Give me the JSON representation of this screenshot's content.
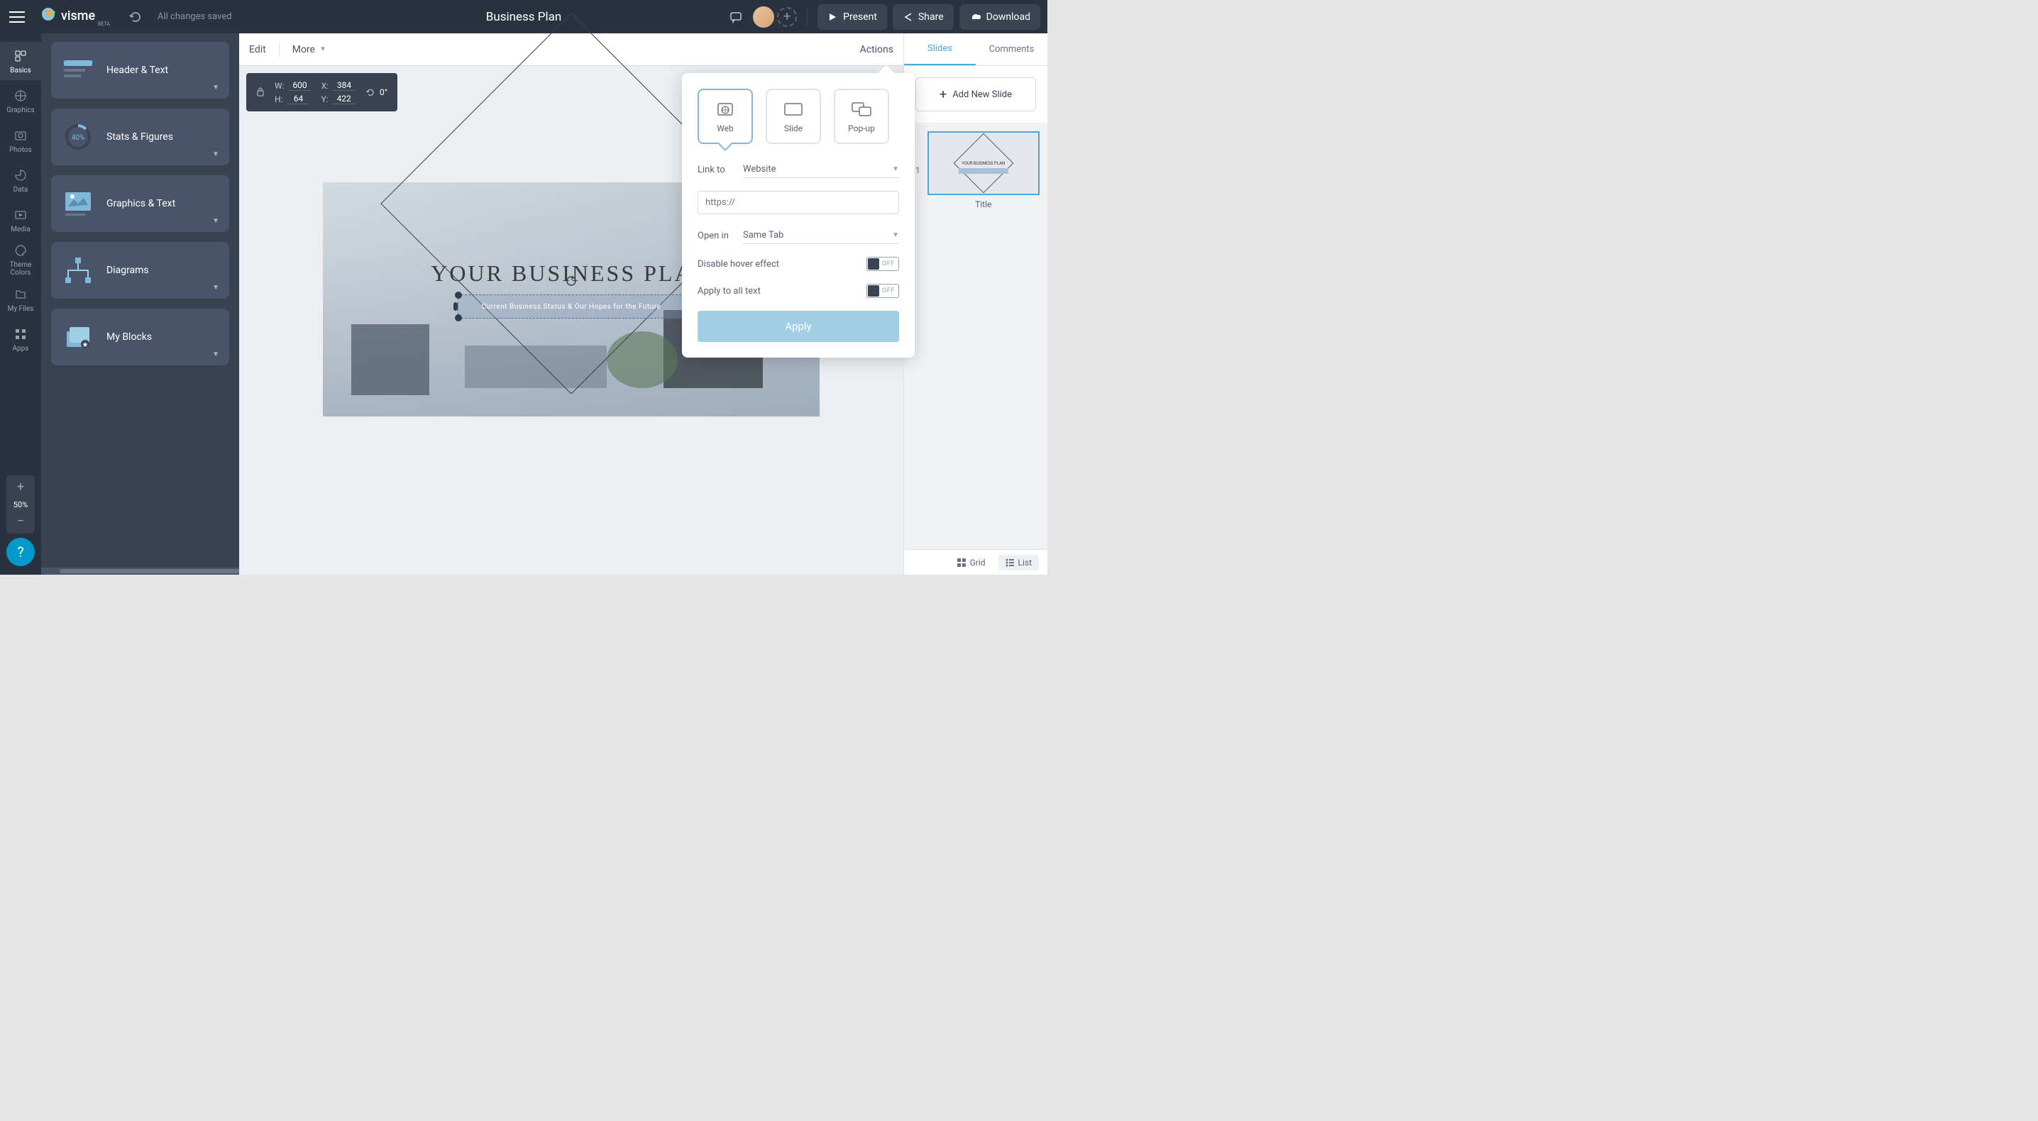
{
  "topbar": {
    "save_status": "All changes saved",
    "project_title": "Business Plan",
    "present": "Present",
    "share": "Share",
    "download": "Download",
    "add_user": "+",
    "logo_beta": "BETA"
  },
  "rail": {
    "items": [
      {
        "label": "Basics"
      },
      {
        "label": "Graphics"
      },
      {
        "label": "Photos"
      },
      {
        "label": "Data"
      },
      {
        "label": "Media"
      },
      {
        "label": "Theme Colors"
      },
      {
        "label": "My Files"
      },
      {
        "label": "Apps"
      }
    ],
    "zoom": "50%"
  },
  "blocks": [
    {
      "label": "Header & Text"
    },
    {
      "label": "Stats & Figures",
      "stat": "40%"
    },
    {
      "label": "Graphics & Text"
    },
    {
      "label": "Diagrams"
    },
    {
      "label": "My Blocks"
    }
  ],
  "canvas_toolbar": {
    "edit": "Edit",
    "more": "More",
    "actions": "Actions"
  },
  "dims": {
    "w_label": "W:",
    "w": "600",
    "h_label": "H:",
    "h": "64",
    "x_label": "X:",
    "x": "384",
    "y_label": "Y:",
    "y": "422",
    "rot": "0°"
  },
  "slide_content": {
    "title": "YOUR BUSINESS PLAN",
    "subtitle": "Current Business Status & Our Hopes for the Future"
  },
  "popover": {
    "types": [
      {
        "label": "Web"
      },
      {
        "label": "Slide"
      },
      {
        "label": "Pop-up"
      }
    ],
    "link_to_label": "Link to",
    "link_to_value": "Website",
    "url_placeholder": "https://",
    "open_in_label": "Open in",
    "open_in_value": "Same Tab",
    "disable_hover": "Disable hover effect",
    "apply_all": "Apply to all text",
    "toggle_off": "OFF",
    "apply_btn": "Apply"
  },
  "right": {
    "tabs": {
      "slides": "Slides",
      "comments": "Comments"
    },
    "add_slide": "Add New Slide",
    "slide1": {
      "num": "1",
      "label": "Title",
      "thumb_title": "YOUR BUSINESS PLAN"
    }
  },
  "view_bar": {
    "grid": "Grid",
    "list": "List"
  }
}
